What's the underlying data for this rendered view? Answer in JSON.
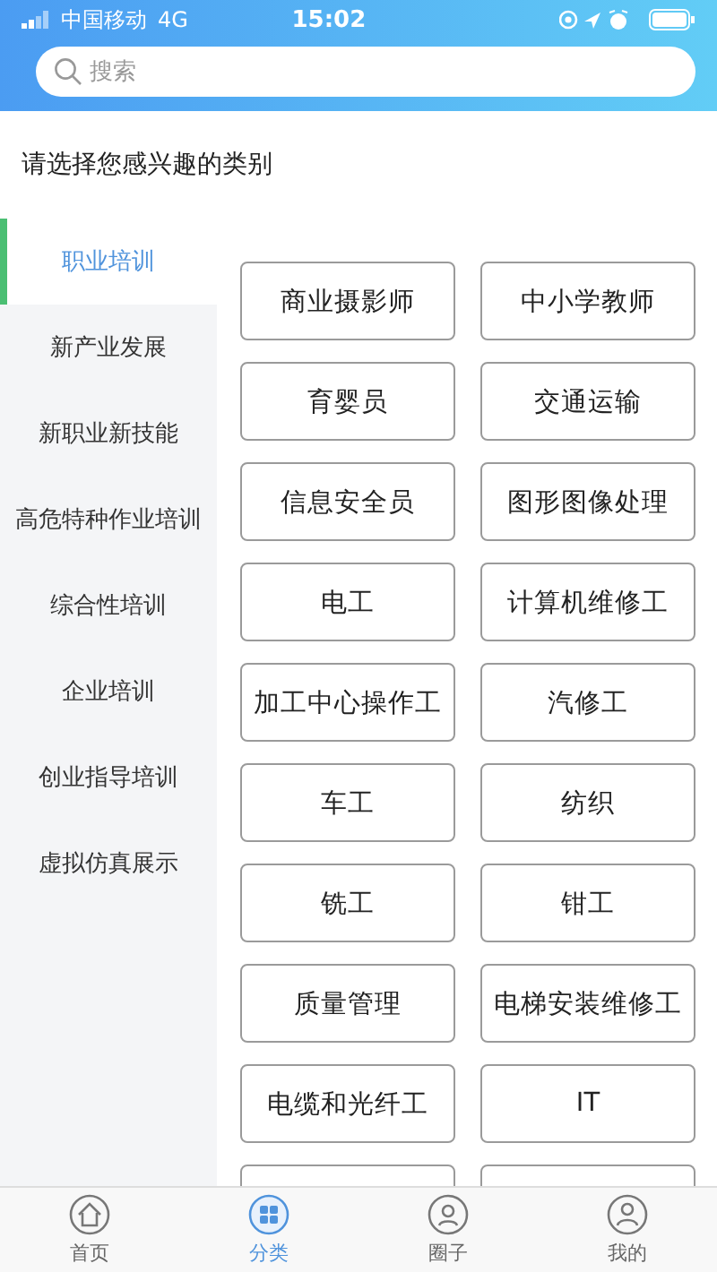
{
  "status_bar": {
    "carrier": "中国移动",
    "network": "4G",
    "time": "15:02"
  },
  "search": {
    "placeholder": "搜索"
  },
  "prompt": "请选择您感兴趣的类别",
  "sidebar": {
    "items": [
      {
        "label": "职业培训",
        "selected": true
      },
      {
        "label": "新产业发展",
        "selected": false
      },
      {
        "label": "新职业新技能",
        "selected": false
      },
      {
        "label": "高危特种作业培训",
        "selected": false
      },
      {
        "label": "综合性培训",
        "selected": false
      },
      {
        "label": "企业培训",
        "selected": false
      },
      {
        "label": "创业指导培训",
        "selected": false
      },
      {
        "label": "虚拟仿真展示",
        "selected": false
      }
    ]
  },
  "categories": [
    "商业摄影师",
    "中小学教师",
    "育婴员",
    "交通运输",
    "信息安全员",
    "图形图像处理",
    "电工",
    "计算机维修工",
    "加工中心操作工",
    "汽修工",
    "车工",
    "纺织",
    "铣工",
    "钳工",
    "质量管理",
    "电梯安装维修工",
    "电缆和光纤工",
    "IT"
  ],
  "tab_bar": [
    {
      "label": "首页",
      "kind": "home",
      "selected": false
    },
    {
      "label": "分类",
      "kind": "category",
      "selected": true
    },
    {
      "label": "圈子",
      "kind": "circle",
      "selected": false
    },
    {
      "label": "我的",
      "kind": "profile",
      "selected": false
    }
  ]
}
